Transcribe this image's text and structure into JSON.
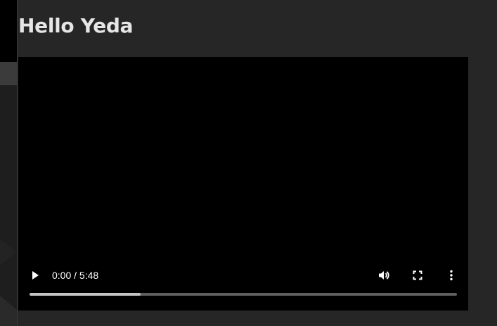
{
  "page": {
    "title": "Hello Yeda"
  },
  "video": {
    "current_time": "0:00",
    "duration": "5:48",
    "time_display": "0:00 / 5:48",
    "buffered_fraction": 0.26,
    "icons": {
      "play": "play-icon",
      "volume": "volume-icon",
      "fullscreen": "fullscreen-icon",
      "more": "more-vert-icon"
    }
  },
  "colors": {
    "background": "#262626",
    "video_background": "#000000",
    "title_text": "#e6e6e6",
    "progress_track": "#5f5f5f",
    "progress_buffered": "#c4c4c4"
  }
}
